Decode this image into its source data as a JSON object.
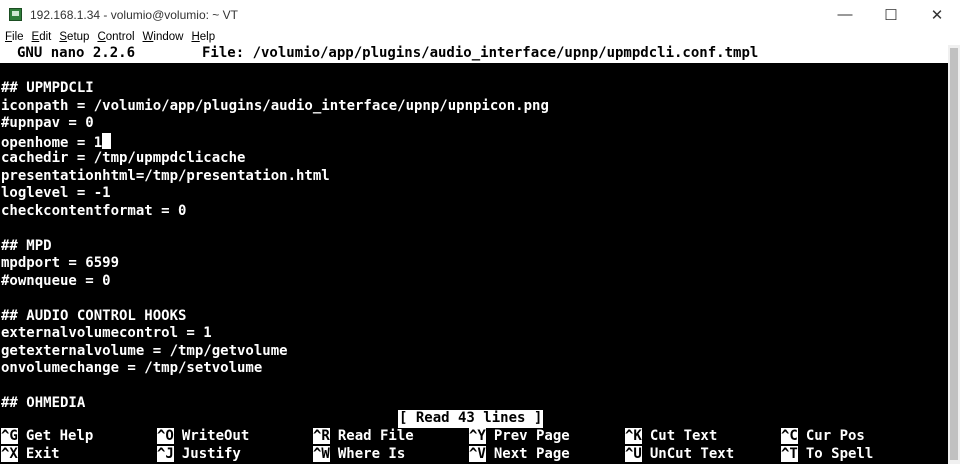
{
  "window": {
    "title": "192.168.1.34 - volumio@volumio: ~ VT",
    "controls": {
      "minimize": "—",
      "maximize": "☐",
      "close": "✕"
    }
  },
  "menu": [
    {
      "mnemonic": "F",
      "rest": "ile"
    },
    {
      "mnemonic": "E",
      "rest": "dit"
    },
    {
      "mnemonic": "S",
      "rest": "etup"
    },
    {
      "mnemonic": "C",
      "rest": "ontrol"
    },
    {
      "mnemonic": "W",
      "rest": "indow"
    },
    {
      "mnemonic": "H",
      "rest": "elp"
    }
  ],
  "nano": {
    "version": "GNU nano 2.2.6",
    "file": "File: /volumio/app/plugins/audio_interface/upnp/upmpdcli.conf.tmpl"
  },
  "lines": [
    "",
    "## UPMPDCLI",
    "iconpath = /volumio/app/plugins/audio_interface/upnp/upnpicon.png",
    "#upnpav = 0",
    "openhome = 1",
    "cachedir = /tmp/upmpdclicache",
    "presentationhtml=/tmp/presentation.html",
    "loglevel = -1",
    "checkcontentformat = 0",
    "",
    "## MPD",
    "mpdport = 6599",
    "#ownqueue = 0",
    "",
    "## AUDIO CONTROL HOOKS",
    "externalvolumecontrol = 1",
    "getexternalvolume = /tmp/getvolume",
    "onvolumechange = /tmp/setvolume",
    "",
    "## OHMEDIA"
  ],
  "status": "[ Read 43 lines ]",
  "shortcuts": [
    [
      {
        "key": "^G",
        "label": "Get Help"
      },
      {
        "key": "^O",
        "label": "WriteOut"
      },
      {
        "key": "^R",
        "label": "Read File"
      },
      {
        "key": "^Y",
        "label": "Prev Page"
      },
      {
        "key": "^K",
        "label": "Cut Text"
      },
      {
        "key": "^C",
        "label": "Cur Pos"
      }
    ],
    [
      {
        "key": "^X",
        "label": "Exit"
      },
      {
        "key": "^J",
        "label": "Justify"
      },
      {
        "key": "^W",
        "label": "Where Is"
      },
      {
        "key": "^V",
        "label": "Next Page"
      },
      {
        "key": "^U",
        "label": "UnCut Text"
      },
      {
        "key": "^T",
        "label": "To Spell"
      }
    ]
  ]
}
